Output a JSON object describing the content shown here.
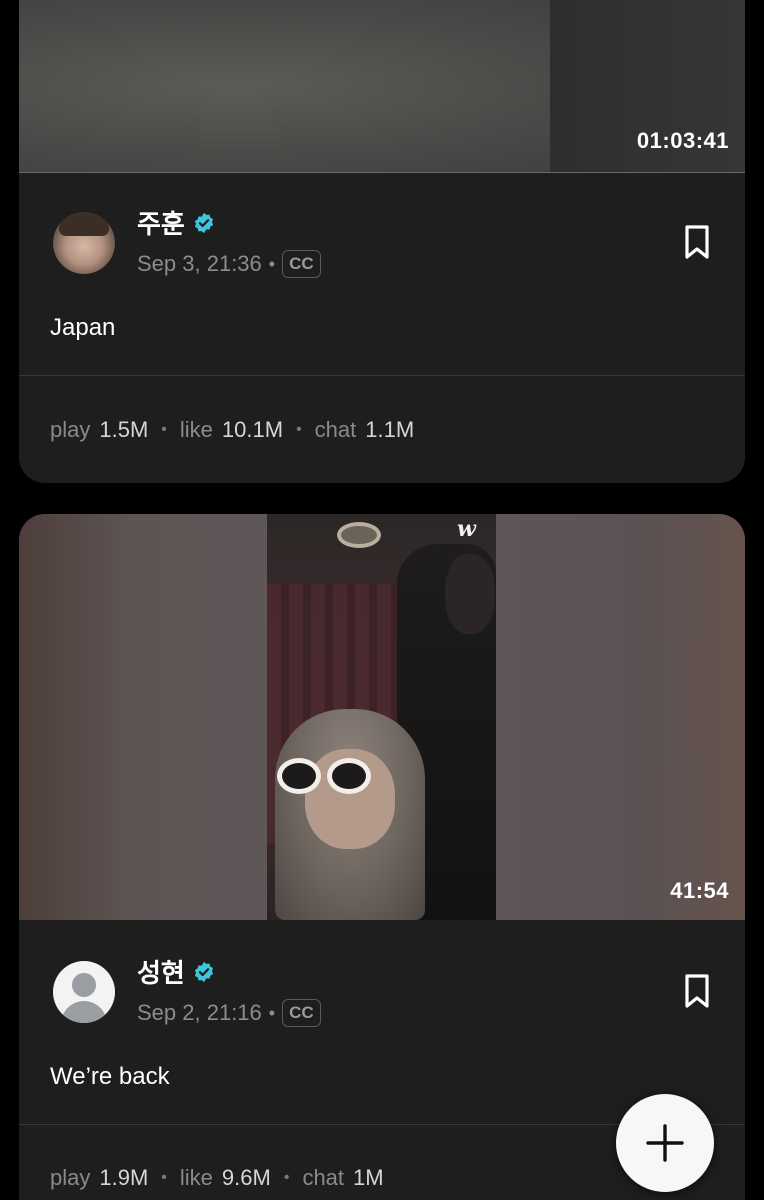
{
  "posts": [
    {
      "author": "주훈",
      "verified": true,
      "timestamp": "Sep 3, 21:36",
      "cc_label": "CC",
      "caption": "Japan",
      "duration": "01:03:41",
      "avatar": "profile-photo",
      "stats": {
        "play_label": "play",
        "play": "1.5M",
        "like_label": "like",
        "like": "10.1M",
        "chat_label": "chat",
        "chat": "1.1M"
      }
    },
    {
      "author": "성현",
      "verified": true,
      "timestamp": "Sep 2, 21:16",
      "cc_label": "CC",
      "caption": "We’re back",
      "duration": "41:54",
      "avatar": "default-avatar",
      "watermark": "w",
      "stats": {
        "play_label": "play",
        "play": "1.9M",
        "like_label": "like",
        "like": "9.6M",
        "chat_label": "chat",
        "chat": "1M"
      }
    }
  ],
  "separator": "•",
  "fab_icon": "plus-icon",
  "colors": {
    "background": "#000000",
    "card": "#1e1e1e",
    "verified": "#3cc7dc",
    "muted_text": "#8c8c8c"
  }
}
